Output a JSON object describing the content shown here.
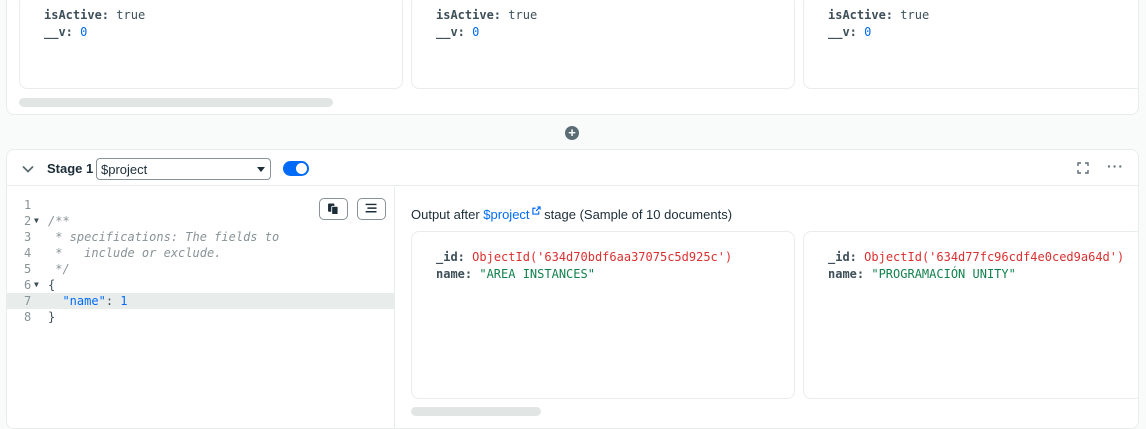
{
  "prev_stage": {
    "documents": [
      {
        "isActive_key": "isActive:",
        "isActive_value": "true",
        "v_key": "__v:",
        "v_value": "0"
      },
      {
        "isActive_key": "isActive:",
        "isActive_value": "true",
        "v_key": "__v:",
        "v_value": "0"
      },
      {
        "isActive_key": "isActive:",
        "isActive_value": "true",
        "v_key": "__v:",
        "v_value": "0"
      }
    ]
  },
  "add_stage_icon": "plus-circle-icon",
  "stage": {
    "label": "Stage 1",
    "operator": "$project",
    "enabled": true,
    "accent_color": "#016bf8",
    "editor": {
      "lines": [
        {
          "n": "1",
          "text": ""
        },
        {
          "n": "2",
          "text": "/**"
        },
        {
          "n": "3",
          "text": " * specifications: The fields to"
        },
        {
          "n": "4",
          "text": " *   include or exclude."
        },
        {
          "n": "5",
          "text": " */"
        },
        {
          "n": "6",
          "text": "{"
        },
        {
          "n": "7",
          "key": "\"name\"",
          "sep": ": ",
          "value": "1"
        },
        {
          "n": "8",
          "text": "}"
        }
      ]
    },
    "output": {
      "prefix": "Output after",
      "link": "$project",
      "suffix": "stage (Sample of 10 documents)",
      "documents": [
        {
          "id_key": "_id:",
          "id_value": "ObjectId('634d70bdf6aa37075c5d925c')",
          "name_key": "name:",
          "name_value": "\"AREA INSTANCES\""
        },
        {
          "id_key": "_id:",
          "id_value": "ObjectId('634d77fc96cdf4e0ced9a64d')",
          "name_key": "name:",
          "name_value": "\"PROGRAMACIÓN UNITY\""
        }
      ]
    }
  }
}
